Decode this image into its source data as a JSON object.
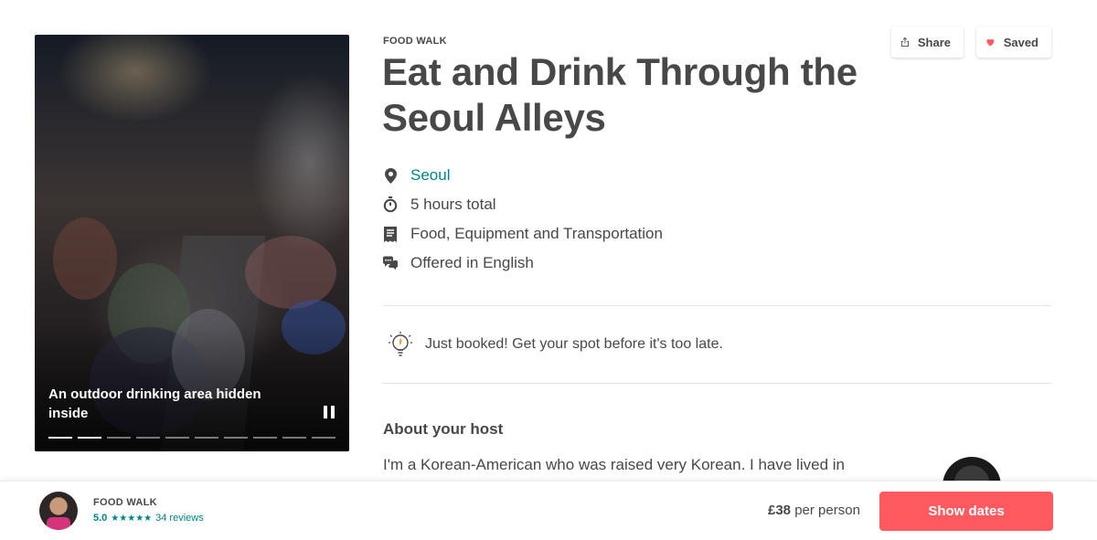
{
  "story": {
    "caption": "An outdoor drinking area hidden inside",
    "progress_total": 10,
    "progress_done": 2
  },
  "experience": {
    "category": "FOOD WALK",
    "title": "Eat and Drink Through the Seoul Alleys"
  },
  "actions": {
    "share_label": "Share",
    "saved_label": "Saved",
    "saved_heart_color": "#ff5a5f"
  },
  "facts": {
    "location": "Seoul",
    "duration": "5 hours total",
    "includes": "Food, Equipment and Transportation",
    "language": "Offered in English"
  },
  "booked_notice": "Just booked! Get your spot before it's too late.",
  "host": {
    "heading": "About your host",
    "bio_excerpt": "I'm a Korean-American who was raised very Korean. I have lived in"
  },
  "booking_bar": {
    "category": "FOOD WALK",
    "rating": "5.0",
    "stars": "★★★★★",
    "reviews": "34 reviews",
    "price": "£38",
    "price_suffix": "per person",
    "cta": "Show dates"
  },
  "colors": {
    "accent": "#ff5a5f",
    "teal": "#008489",
    "text": "#484848"
  }
}
